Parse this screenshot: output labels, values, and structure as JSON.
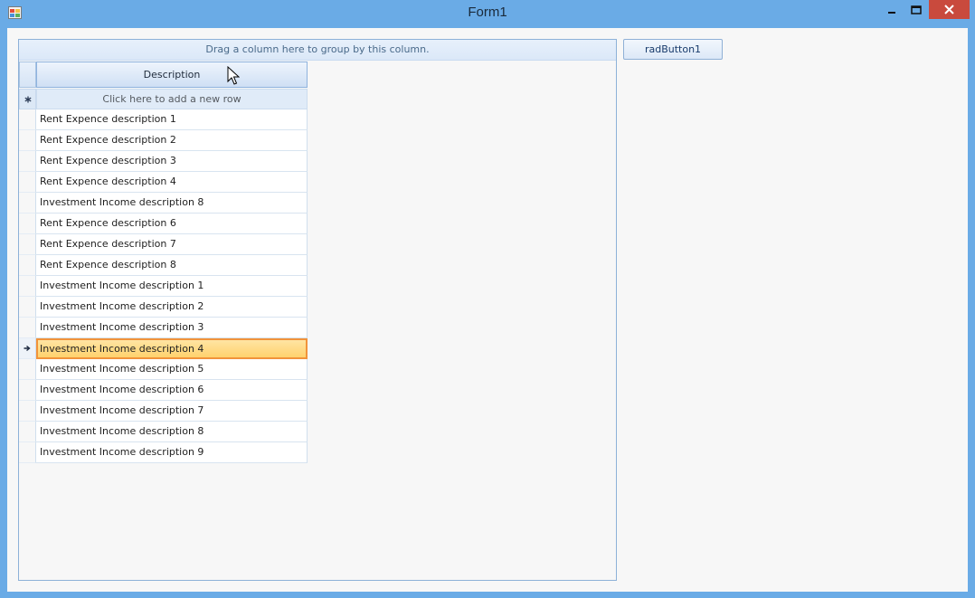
{
  "window": {
    "title": "Form1",
    "icon": "app-form-icon",
    "controls": [
      "minimize-icon",
      "maximize-icon",
      "close-icon"
    ]
  },
  "grid": {
    "group_panel_text": "Drag a column here to group by this column.",
    "columns": [
      "Description"
    ],
    "new_row_text": "Click here to add a new row",
    "rows": [
      "Rent Expence description 1",
      "Rent Expence description 2",
      "Rent Expence description 3",
      "Rent Expence description 4",
      "Investment Income description 8",
      "Rent Expence description 6",
      "Rent Expence description 7",
      "Rent Expence description 8",
      "Investment Income description 1",
      "Investment Income description 2",
      "Investment Income description 3",
      "Investment Income description 4",
      "Investment Income description 5",
      "Investment Income description 6",
      "Investment Income description 7",
      "Investment Income description 8",
      "Investment Income description 9"
    ],
    "selected_row_index": 11
  },
  "button": {
    "label": "radButton1"
  },
  "colors": {
    "titlebar": "#6aabe6",
    "close_button": "#c94a3d",
    "selection_fill": "#ffd26d",
    "selection_border": "#f1933a"
  }
}
